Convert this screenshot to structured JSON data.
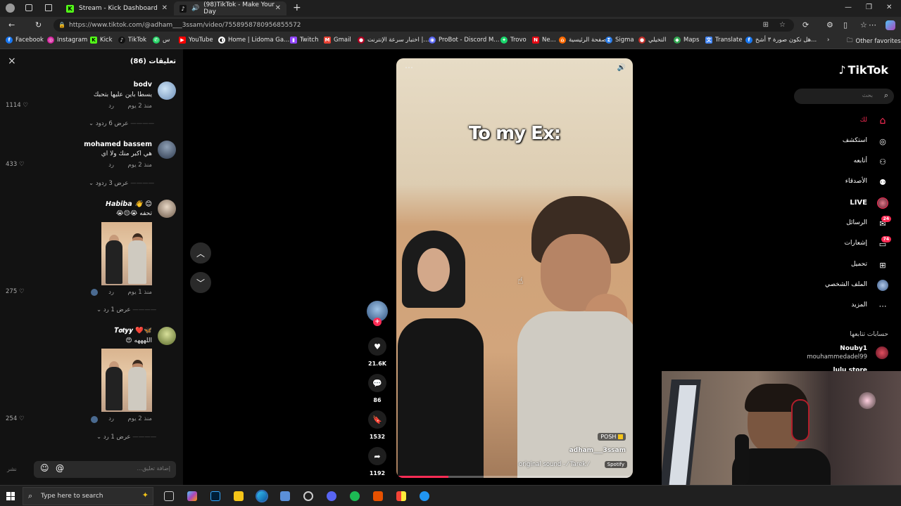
{
  "browser": {
    "tabs": [
      {
        "label": "Stream - Kick Dashboard",
        "favicon": "K",
        "color": "#53fc18"
      },
      {
        "label": "(98)TikTok - Make Your Day",
        "favicon": "♪",
        "color": "#111111"
      }
    ],
    "new_tab": "+",
    "url": "https://www.tiktok.com/@adham___3ssam/video/7558958780956855572",
    "bookmarks": [
      {
        "label": "Facebook",
        "color": "#1877f2",
        "glyph": "f"
      },
      {
        "label": "Instagram",
        "color": "#d6249f",
        "glyph": "◎"
      },
      {
        "label": "Kick",
        "color": "#53fc18",
        "glyph": "K"
      },
      {
        "label": "TikTok",
        "color": "#111111",
        "glyph": "♪"
      },
      {
        "label": "س",
        "color": "#25d366",
        "glyph": "✆"
      },
      {
        "label": "YouTube",
        "color": "#ff0000",
        "glyph": "▶"
      },
      {
        "label": "Home | Lidoma Ga...",
        "color": "#ffffff",
        "glyph": "◐"
      },
      {
        "label": "Twitch",
        "color": "#9146ff",
        "glyph": "▮"
      },
      {
        "label": "Gmail",
        "color": "#ea4335",
        "glyph": "M"
      },
      {
        "label": "اختبار سرعة الإنترنت |...",
        "color": "#b00020",
        "glyph": "●"
      },
      {
        "label": "ProBot - Discord M...",
        "color": "#5865f2",
        "glyph": "◉"
      },
      {
        "label": "Trovo",
        "color": "#19d66b",
        "glyph": "✦"
      },
      {
        "label": "Ne...",
        "color": "#e50914",
        "glyph": "N"
      },
      {
        "label": "الصفحة الرئيسية",
        "color": "#ff6a00",
        "glyph": "⌂"
      },
      {
        "label": "Sigma",
        "color": "#2b7de9",
        "glyph": "Σ"
      },
      {
        "label": "التخيلي",
        "color": "#c4302b",
        "glyph": "●"
      },
      {
        "label": "Maps",
        "color": "#34a853",
        "glyph": "◆"
      },
      {
        "label": "Translate",
        "color": "#4285f4",
        "glyph": "文"
      },
      {
        "label": "هل تكون صورة ٣ أشخ...",
        "color": "#1877f2",
        "glyph": "f"
      }
    ],
    "other_favorites": "Other favorites"
  },
  "comments_panel": {
    "title": "تعليقات (86)",
    "close": "×",
    "items": [
      {
        "name": "bodv",
        "text": "يسطا باين عليها بتحبك",
        "time": "منذ 2 يوم",
        "reply": "رد",
        "likes": "1114",
        "replies": "عرض 6 ردود",
        "avatar_color": "#7a9ec8"
      },
      {
        "name": "mohamed bassem",
        "text": "هي اكبر منك ولا اي",
        "time": "منذ 2 يوم",
        "reply": "رد",
        "likes": "433",
        "replies": "عرض 3 ردود",
        "avatar_color": "#4a5a70"
      },
      {
        "name": "Habiba 👋 😊",
        "text": "تحفه 😭😌😭",
        "time": "منذ 1 يوم",
        "reply": "رد",
        "likes": "275",
        "replies": "عرض 1 رد",
        "avatar_color": "#c9b8a6"
      },
      {
        "name": "𝑻𝒐𝒕𝒚𝒚 ❤️🦋",
        "text": "اللهههه 😍",
        "time": "منذ 2 يوم",
        "reply": "رد",
        "likes": "254",
        "replies": "عرض 1 رد",
        "avatar_color": "#9aa86a"
      }
    ],
    "input_placeholder": "إضافة تعليق...",
    "post_label": "نشر"
  },
  "video": {
    "overlay_text": "To my Ex:",
    "author": "adham___3ssam",
    "sound": "original sound - ⁄ Tarek ⁄",
    "badge_posh": "POSH",
    "badge_spotify": "Spotify",
    "likes": "21.6K",
    "comments": "86",
    "saves": "1532",
    "shares": "1192",
    "progress": 0.22
  },
  "tiktok_nav": {
    "logo": "TikTok",
    "search_placeholder": "بحث",
    "items": [
      {
        "label": "لك",
        "icon": "home-icon",
        "glyph": "⌂",
        "active": true
      },
      {
        "label": "استكشف",
        "icon": "compass-icon",
        "glyph": "◎"
      },
      {
        "label": "أتابعه",
        "icon": "following-icon",
        "glyph": "👤"
      },
      {
        "label": "الأصدقاء",
        "icon": "friends-icon",
        "glyph": "👥"
      },
      {
        "label": "LIVE",
        "icon": "live-icon",
        "glyph": "●"
      },
      {
        "label": "الرسائل",
        "icon": "messages-icon",
        "glyph": "✉",
        "badge": "24"
      },
      {
        "label": "إشعارات",
        "icon": "inbox-icon",
        "glyph": "▭",
        "badge": "74"
      },
      {
        "label": "تحميل",
        "icon": "upload-icon",
        "glyph": "⊞"
      },
      {
        "label": "الملف الشخصي",
        "icon": "profile-icon",
        "glyph": "●"
      },
      {
        "label": "المزيد",
        "icon": "more-icon",
        "glyph": "⋯"
      }
    ],
    "following_title": "حسابات تتابعها",
    "following": [
      {
        "name": "Nouby1",
        "handle": "mouhammedadel99"
      },
      {
        "name": "lulu store",
        "handle": ""
      }
    ]
  },
  "taskbar": {
    "search_placeholder": "Type here to search"
  }
}
